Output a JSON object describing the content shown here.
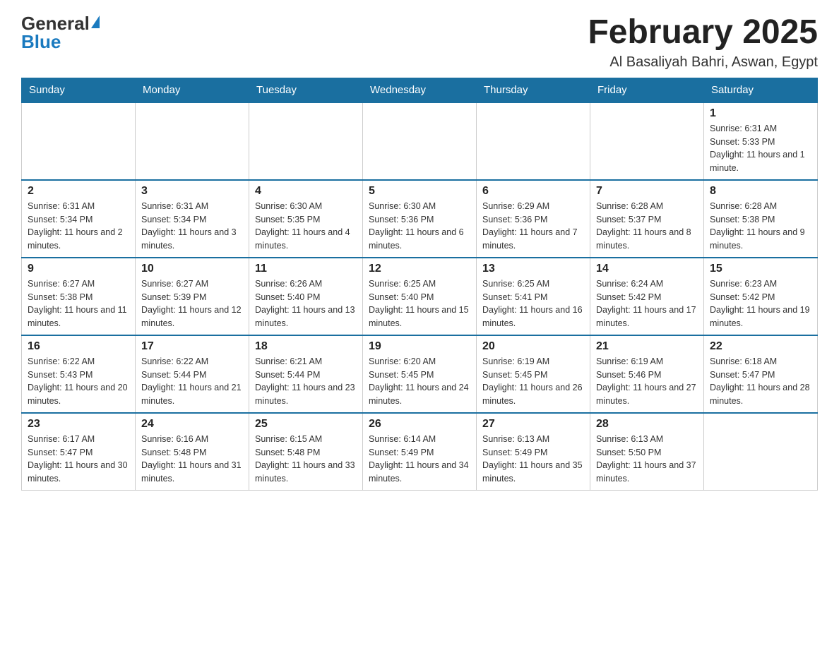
{
  "logo": {
    "general": "General",
    "blue": "Blue",
    "aria": "GeneralBlue logo"
  },
  "title": {
    "month_year": "February 2025",
    "location": "Al Basaliyah Bahri, Aswan, Egypt"
  },
  "weekdays": [
    "Sunday",
    "Monday",
    "Tuesday",
    "Wednesday",
    "Thursday",
    "Friday",
    "Saturday"
  ],
  "weeks": [
    {
      "days": [
        {
          "num": "",
          "info": ""
        },
        {
          "num": "",
          "info": ""
        },
        {
          "num": "",
          "info": ""
        },
        {
          "num": "",
          "info": ""
        },
        {
          "num": "",
          "info": ""
        },
        {
          "num": "",
          "info": ""
        },
        {
          "num": "1",
          "info": "Sunrise: 6:31 AM\nSunset: 5:33 PM\nDaylight: 11 hours and 1 minute."
        }
      ]
    },
    {
      "days": [
        {
          "num": "2",
          "info": "Sunrise: 6:31 AM\nSunset: 5:34 PM\nDaylight: 11 hours and 2 minutes."
        },
        {
          "num": "3",
          "info": "Sunrise: 6:31 AM\nSunset: 5:34 PM\nDaylight: 11 hours and 3 minutes."
        },
        {
          "num": "4",
          "info": "Sunrise: 6:30 AM\nSunset: 5:35 PM\nDaylight: 11 hours and 4 minutes."
        },
        {
          "num": "5",
          "info": "Sunrise: 6:30 AM\nSunset: 5:36 PM\nDaylight: 11 hours and 6 minutes."
        },
        {
          "num": "6",
          "info": "Sunrise: 6:29 AM\nSunset: 5:36 PM\nDaylight: 11 hours and 7 minutes."
        },
        {
          "num": "7",
          "info": "Sunrise: 6:28 AM\nSunset: 5:37 PM\nDaylight: 11 hours and 8 minutes."
        },
        {
          "num": "8",
          "info": "Sunrise: 6:28 AM\nSunset: 5:38 PM\nDaylight: 11 hours and 9 minutes."
        }
      ]
    },
    {
      "days": [
        {
          "num": "9",
          "info": "Sunrise: 6:27 AM\nSunset: 5:38 PM\nDaylight: 11 hours and 11 minutes."
        },
        {
          "num": "10",
          "info": "Sunrise: 6:27 AM\nSunset: 5:39 PM\nDaylight: 11 hours and 12 minutes."
        },
        {
          "num": "11",
          "info": "Sunrise: 6:26 AM\nSunset: 5:40 PM\nDaylight: 11 hours and 13 minutes."
        },
        {
          "num": "12",
          "info": "Sunrise: 6:25 AM\nSunset: 5:40 PM\nDaylight: 11 hours and 15 minutes."
        },
        {
          "num": "13",
          "info": "Sunrise: 6:25 AM\nSunset: 5:41 PM\nDaylight: 11 hours and 16 minutes."
        },
        {
          "num": "14",
          "info": "Sunrise: 6:24 AM\nSunset: 5:42 PM\nDaylight: 11 hours and 17 minutes."
        },
        {
          "num": "15",
          "info": "Sunrise: 6:23 AM\nSunset: 5:42 PM\nDaylight: 11 hours and 19 minutes."
        }
      ]
    },
    {
      "days": [
        {
          "num": "16",
          "info": "Sunrise: 6:22 AM\nSunset: 5:43 PM\nDaylight: 11 hours and 20 minutes."
        },
        {
          "num": "17",
          "info": "Sunrise: 6:22 AM\nSunset: 5:44 PM\nDaylight: 11 hours and 21 minutes."
        },
        {
          "num": "18",
          "info": "Sunrise: 6:21 AM\nSunset: 5:44 PM\nDaylight: 11 hours and 23 minutes."
        },
        {
          "num": "19",
          "info": "Sunrise: 6:20 AM\nSunset: 5:45 PM\nDaylight: 11 hours and 24 minutes."
        },
        {
          "num": "20",
          "info": "Sunrise: 6:19 AM\nSunset: 5:45 PM\nDaylight: 11 hours and 26 minutes."
        },
        {
          "num": "21",
          "info": "Sunrise: 6:19 AM\nSunset: 5:46 PM\nDaylight: 11 hours and 27 minutes."
        },
        {
          "num": "22",
          "info": "Sunrise: 6:18 AM\nSunset: 5:47 PM\nDaylight: 11 hours and 28 minutes."
        }
      ]
    },
    {
      "days": [
        {
          "num": "23",
          "info": "Sunrise: 6:17 AM\nSunset: 5:47 PM\nDaylight: 11 hours and 30 minutes."
        },
        {
          "num": "24",
          "info": "Sunrise: 6:16 AM\nSunset: 5:48 PM\nDaylight: 11 hours and 31 minutes."
        },
        {
          "num": "25",
          "info": "Sunrise: 6:15 AM\nSunset: 5:48 PM\nDaylight: 11 hours and 33 minutes."
        },
        {
          "num": "26",
          "info": "Sunrise: 6:14 AM\nSunset: 5:49 PM\nDaylight: 11 hours and 34 minutes."
        },
        {
          "num": "27",
          "info": "Sunrise: 6:13 AM\nSunset: 5:49 PM\nDaylight: 11 hours and 35 minutes."
        },
        {
          "num": "28",
          "info": "Sunrise: 6:13 AM\nSunset: 5:50 PM\nDaylight: 11 hours and 37 minutes."
        },
        {
          "num": "",
          "info": ""
        }
      ]
    }
  ]
}
